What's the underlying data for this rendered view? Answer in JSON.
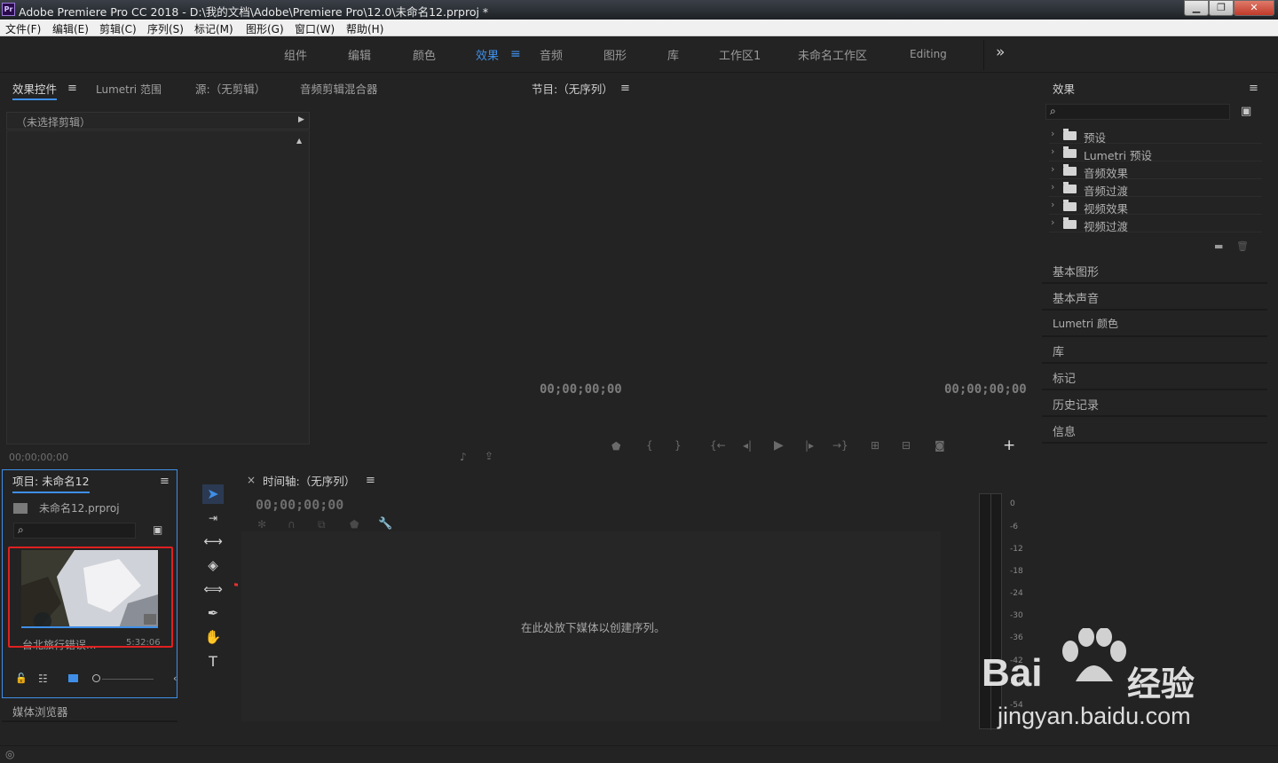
{
  "window": {
    "app_icon": "Pr",
    "title": "Adobe Premiere Pro CC 2018 - D:\\我的文档\\Adobe\\Premiere Pro\\12.0\\未命名12.prproj *",
    "min": "▁",
    "max": "❐",
    "close": "✕"
  },
  "menu": [
    "文件(F)",
    "编辑(E)",
    "剪辑(C)",
    "序列(S)",
    "标记(M)",
    "图形(G)",
    "窗口(W)",
    "帮助(H)"
  ],
  "workspaces": {
    "items": [
      "组件",
      "编辑",
      "颜色",
      "效果",
      "音频",
      "图形",
      "库",
      "工作区1",
      "未命名工作区",
      "Editing"
    ],
    "active": "效果",
    "more": "»"
  },
  "source_panel": {
    "tabs": [
      "效果控件",
      "Lumetri 范围",
      "源:（无剪辑）",
      "音频剪辑混合器"
    ],
    "no_clip": "（未选择剪辑）",
    "timecode": "00;00;00;00"
  },
  "program_panel": {
    "title": "节目:（无序列）",
    "timecode_left": "00;00;00;00",
    "timecode_right": "00;00;00;00",
    "add": "+"
  },
  "effects_panel": {
    "title": "效果",
    "items": [
      "预设",
      "Lumetri 预设",
      "音频效果",
      "音频过渡",
      "视频效果",
      "视频过渡"
    ]
  },
  "side_panels": [
    "基本图形",
    "基本声音",
    "Lumetri 颜色",
    "库",
    "标记",
    "历史记录",
    "信息"
  ],
  "project_panel": {
    "title": "项目: 未命名12",
    "file": "未命名12.prproj",
    "clip_name": "台北旅行错误...",
    "clip_duration": "5:32:06"
  },
  "media_browser": "媒体浏览器",
  "timeline": {
    "close": "×",
    "title": "时间轴:（无序列）",
    "timecode": "00;00;00;00",
    "drop_hint": "在此处放下媒体以创建序列。"
  },
  "audio_meter": {
    "labels": [
      "0",
      "-6",
      "-12",
      "-18",
      "-24",
      "-30",
      "-36",
      "-42",
      "-48",
      "-54"
    ]
  },
  "watermark": {
    "brand": "Bai",
    "brand_cn": "经验",
    "url": "jingyan.baidu.com"
  },
  "colors": {
    "accent": "#3f8fe8",
    "highlight_box": "#e02020",
    "arrow": "#e83030"
  }
}
